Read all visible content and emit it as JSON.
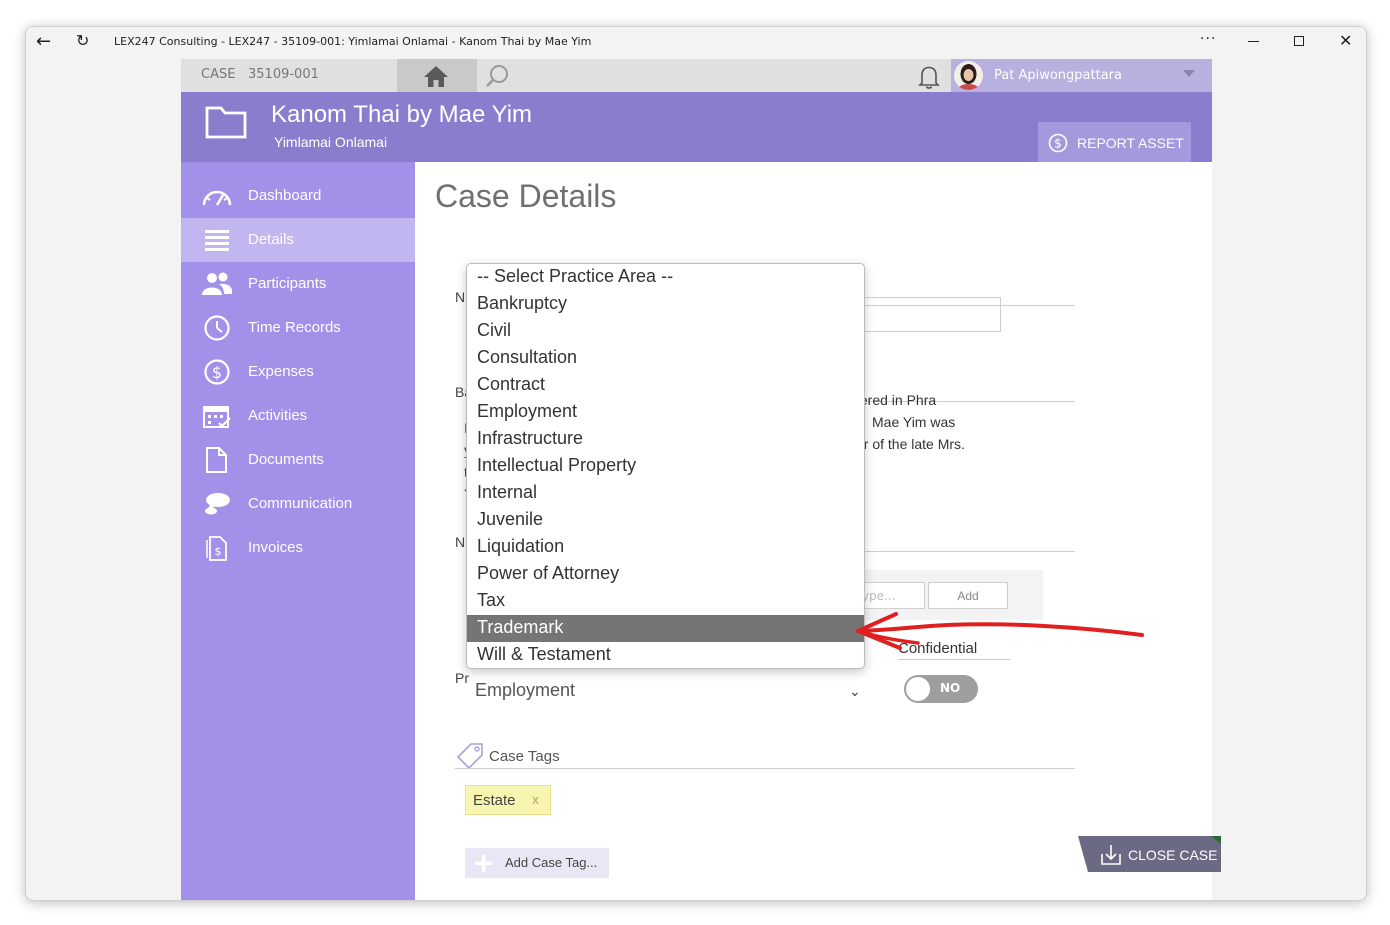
{
  "window": {
    "title": "LEX247 Consulting - LEX247 - 35109-001: Yimlamai Onlamai - Kanom Thai by Mae Yim",
    "more_glyph": "···",
    "close_glyph": "✕"
  },
  "topbar": {
    "case_label": "CASE",
    "case_number": "35109-001",
    "user_name": "Pat Apiwongpattara"
  },
  "header": {
    "title": "Kanom Thai by Mae Yim",
    "subtitle": "Yimlamai Onlamai",
    "report_asset_label": "REPORT ASSET"
  },
  "sidebar": {
    "items": [
      {
        "label": "Dashboard",
        "icon": "dashboard-icon"
      },
      {
        "label": "Details",
        "icon": "list-icon",
        "active": true
      },
      {
        "label": "Participants",
        "icon": "people-icon"
      },
      {
        "label": "Time Records",
        "icon": "clock-icon"
      },
      {
        "label": "Expenses",
        "icon": "dollar-icon"
      },
      {
        "label": "Activities",
        "icon": "calendar-icon"
      },
      {
        "label": "Documents",
        "icon": "document-icon"
      },
      {
        "label": "Communication",
        "icon": "chat-icon"
      },
      {
        "label": "Invoices",
        "icon": "invoice-icon"
      }
    ]
  },
  "main": {
    "page_title": "Case Details",
    "name_label_fragment": "N",
    "background_label_fragment": "Ba",
    "notes_label_fragment": "N",
    "practice_label_fragment": "Pr",
    "background_text_lines": [
      "tered in Phra",
      "Mae Yim was",
      "er of the late Mrs."
    ],
    "background_text_edge_glyphs": [
      "I",
      "y",
      "t",
      "Y"
    ],
    "type_placeholder": "ype...",
    "add_label": "Add",
    "confidential_label": "Confidential",
    "confidential_value": "NO",
    "practice_area_value": "Employment",
    "select_caret": "⌄",
    "case_tags_label": "Case Tags",
    "tags": [
      {
        "label": "Estate",
        "remove": "x"
      }
    ],
    "add_tag_label": "Add Case Tag...",
    "add_tag_plus": "+"
  },
  "close_case_label": "CLOSE CASE",
  "dropdown": {
    "options": [
      "-- Select Practice Area --",
      "Bankruptcy",
      "Civil",
      "Consultation",
      "Contract",
      "Employment",
      "Infrastructure",
      "Intellectual Property",
      "Internal",
      "Juvenile",
      "Liquidation",
      "Power of Attorney",
      "Tax",
      "Trademark",
      "Will & Testament"
    ],
    "highlighted": "Trademark"
  },
  "colors": {
    "header": "#8b7dce",
    "sidebar": "#a390e8",
    "sidebar_active": "#c2b6f0",
    "highlight": "#757575",
    "annotation_arrow": "#e02020"
  }
}
